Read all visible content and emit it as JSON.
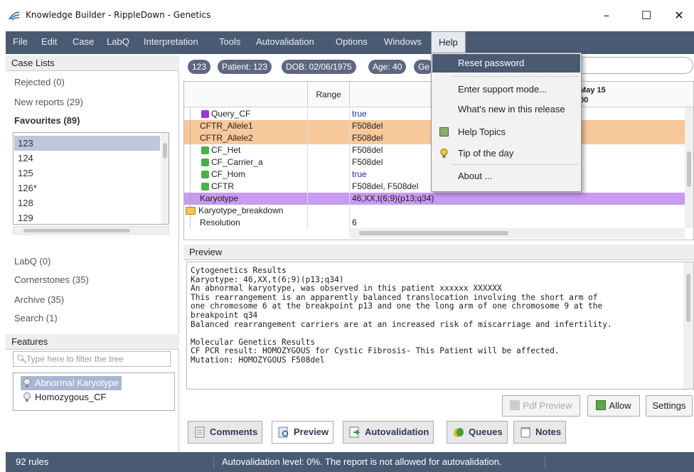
{
  "window": {
    "title": "Knowledge Builder - RippleDown - Genetics"
  },
  "menu": {
    "items": [
      "File",
      "Edit",
      "Case",
      "LabQ",
      "Interpretation",
      "Tools",
      "Autovalidation",
      "Options",
      "Windows",
      "Help"
    ],
    "active": "Help"
  },
  "help_menu": {
    "items": [
      "Reset password",
      "Enter support mode...",
      "What's new in this release",
      "Help Topics",
      "Tip of the day",
      "About ..."
    ]
  },
  "left": {
    "case_lists_header": "Case Lists",
    "rejected": "Rejected (0)",
    "new_reports": "New reports (29)",
    "favourites": "Favourites (89)",
    "cases": [
      "123",
      "124",
      "125",
      "126*",
      "128",
      "129"
    ],
    "selected_case": "123",
    "labq": "LabQ (0)",
    "cornerstones": "Cornerstones (35)",
    "archive": "Archive (35)",
    "search": "Search (1)",
    "features_header": "Features",
    "filter_placeholder": "Type here to filter the tree",
    "features": [
      "Abnormal Karyotype",
      "Homozygous_CF"
    ]
  },
  "chips": [
    "123",
    "Patient: 123",
    "DOB: 02/06/1975",
    "Age: 40",
    "Ge"
  ],
  "grid": {
    "range_header": "Range",
    "date_header_1": "May 15",
    "date_header_2": "00",
    "rows": [
      {
        "name": "Query_CF",
        "value": "true",
        "style": "query"
      },
      {
        "name": "CFTR_Allele1",
        "value": "F508del",
        "style": "orange"
      },
      {
        "name": "CFTR_Allele2",
        "value": "F508del",
        "style": "orange"
      },
      {
        "name": "CF_Het",
        "value": "F508del",
        "style": "rule"
      },
      {
        "name": "CF_Carrier_a",
        "value": "F508del",
        "style": "rule"
      },
      {
        "name": "CF_Hom",
        "value": "true",
        "style": "rule"
      },
      {
        "name": "CFTR",
        "value": "F508del, F508del",
        "style": "rule"
      },
      {
        "name": "Karyotype",
        "value": "46,XX,t(6;9)(p13;q34)",
        "style": "purple"
      },
      {
        "name": "Karyotype_breakdown",
        "value": "",
        "style": "folder"
      },
      {
        "name": "Resolution",
        "value": "6",
        "style": "plain"
      }
    ]
  },
  "preview": {
    "header": "Preview",
    "lines": [
      "Cytogenetics Results",
      "Karyotype: 46,XX,t(6;9)(p13;q34)",
      "An abnormal karyotype, was observed in this patient xxxxxx XXXXXX",
      "This rearrangement is an apparently balanced translocation involving the short arm of",
      "one chromosome 6 at the breakpoint p13 and one the long arm of one chromosome 9 at the",
      "breakpoint q34",
      "Balanced rearrangement carriers are at an increased risk of miscarriage and infertility.",
      "",
      "Molecular Genetics Results",
      "CF PCR result: HOMOZYGOUS for Cystic Fibrosis- This Patient will be affected.",
      "Mutation: HOMOZYGOUS F508del"
    ]
  },
  "buttons": {
    "pdf_preview": "Pdf Preview",
    "allow": "Allow",
    "settings": "Settings"
  },
  "tabs": [
    "Comments",
    "Preview",
    "Autovalidation",
    "Queues",
    "Notes"
  ],
  "active_tab": "Preview",
  "status": {
    "rules": "92 rules",
    "message": "Autovalidation level: 0%. The report is not allowed for autovalidation."
  },
  "colors": {
    "menubar": "#4a5a73",
    "orange_row": "#f7c89b",
    "purple_row": "#c89af0",
    "selection": "#bcc6dc"
  }
}
